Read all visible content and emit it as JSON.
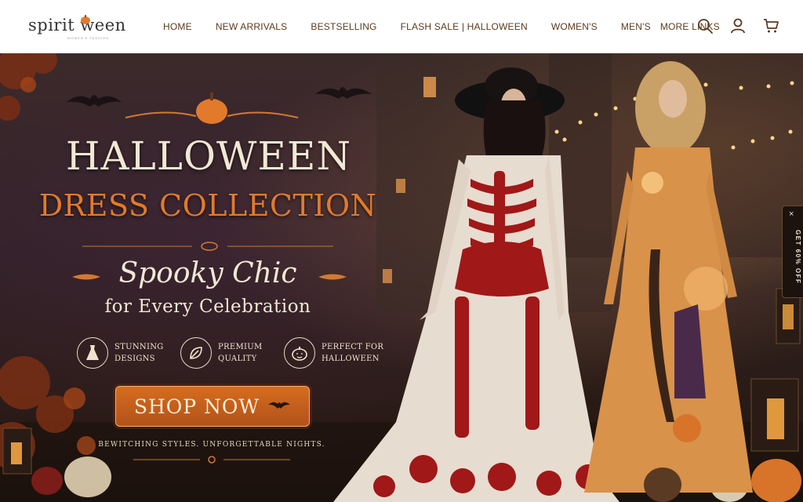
{
  "brand": {
    "name": "spirit ween",
    "tagline": "WOMEN'S FASHION"
  },
  "nav": {
    "items": [
      {
        "label": "HOME"
      },
      {
        "label": "NEW ARRIVALS"
      },
      {
        "label": "BESTSELLING"
      },
      {
        "label": "FLASH SALE | HALLOWEEN"
      },
      {
        "label": "WOMEN'S"
      },
      {
        "label": "MEN'S"
      },
      {
        "label": "MORE LINKS"
      }
    ]
  },
  "header_icons": [
    "search-icon",
    "account-icon",
    "cart-icon"
  ],
  "hero": {
    "title": "HALLOWEEN",
    "subtitle": "DRESS COLLECTION",
    "tagline": "Spooky Chic",
    "tagline2": "for Every Celebration",
    "features": [
      {
        "icon": "dress-icon",
        "line1": "STUNNING",
        "line2": "DESIGNS"
      },
      {
        "icon": "leaf-icon",
        "line1": "PREMIUM",
        "line2": "QUALITY"
      },
      {
        "icon": "pumpkin-icon",
        "line1": "PERFECT FOR",
        "line2": "HALLOWEEN"
      }
    ],
    "cta": "SHOP NOW",
    "note": "BEWITCHING STYLES. UNFORGETTABLE NIGHTS."
  },
  "side_tab": {
    "label": "GET 60% OFF",
    "close": "×"
  },
  "colors": {
    "accent": "#d46d1f",
    "nav_text": "#5a3a1e",
    "title": "#f2e8d5",
    "subtitle": "#e27a2c"
  }
}
